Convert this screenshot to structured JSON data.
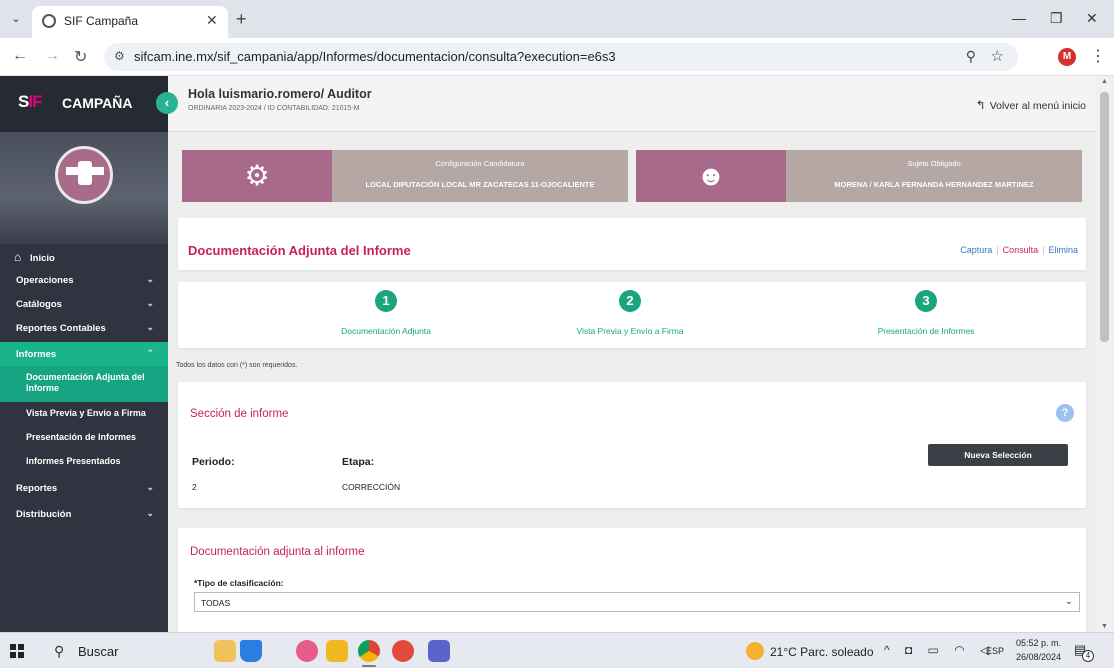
{
  "browser": {
    "tab_title": "SIF Campaña",
    "url": "sifcam.ine.mx/sif_campania/app/Informes/documentacion/consulta?execution=e6s3",
    "profile_initial": "M"
  },
  "sidebar": {
    "logo_mark_a": "S",
    "logo_mark_b": "IF",
    "logo_text": "CAMPAÑA",
    "home_label": "Inicio",
    "items": [
      {
        "label": "Operaciones"
      },
      {
        "label": "Catálogos"
      },
      {
        "label": "Reportes Contables"
      },
      {
        "label": "Informes"
      },
      {
        "label": "Reportes"
      },
      {
        "label": "Distribución"
      }
    ],
    "subitems": [
      {
        "label": "Documentación Adjunta del Informe"
      },
      {
        "label": "Vista Previa y Envío a Firma"
      },
      {
        "label": "Presentación de Informes"
      },
      {
        "label": "Informes Presentados"
      }
    ]
  },
  "header": {
    "greeting": "Hola luismario.romero/ Auditor",
    "subtitle": "ORDINARIA 2023-2024 / ID CONTABILIDAD: 21015-M",
    "back_label": "Volver al menú inicio"
  },
  "cards": [
    {
      "label": "Configuración Candidatura",
      "value": "LOCAL DIPUTACIÓN LOCAL MR ZACATECAS 11-OJOCALIENTE",
      "icon": "gear-icon"
    },
    {
      "label": "Sujeto Obligado",
      "value": "MORENA / KARLA FERNANDA HERNANDEZ MARTINEZ",
      "icon": "user-icon"
    }
  ],
  "doc_panel": {
    "title": "Documentación Adjunta del Informe",
    "links": [
      "Captura",
      "Consulta",
      "Elimina"
    ],
    "current_link": "Consulta"
  },
  "steps": [
    {
      "num": "1",
      "label": "Documentación Adjunta"
    },
    {
      "num": "2",
      "label": "Vista Previa y Envío a Firma"
    },
    {
      "num": "3",
      "label": "Presentación de Informes"
    }
  ],
  "required_note": "Todos los datos con (*) son requeridos.",
  "section": {
    "title": "Sección de informe",
    "button_label": "Nueva Selección",
    "periodo_label": "Periodo:",
    "periodo_value": "2",
    "etapa_label": "Etapa:",
    "etapa_value": "CORRECCIÓN"
  },
  "attached": {
    "title": "Documentación adjunta al informe",
    "select_label": "*Tipo de clasificación:",
    "select_value": "TODAS"
  },
  "taskbar": {
    "search_label": "Buscar",
    "weather": "21°C  Parc. soleado",
    "lang": "ESP",
    "time": "05:52 p. m.",
    "date": "26/08/2024",
    "notif_count": "4"
  },
  "colors": {
    "accent": "#19b48b",
    "title_pink": "#c8205a",
    "card_mauve": "#a9698a",
    "card_taupe": "#b5a8a4"
  }
}
